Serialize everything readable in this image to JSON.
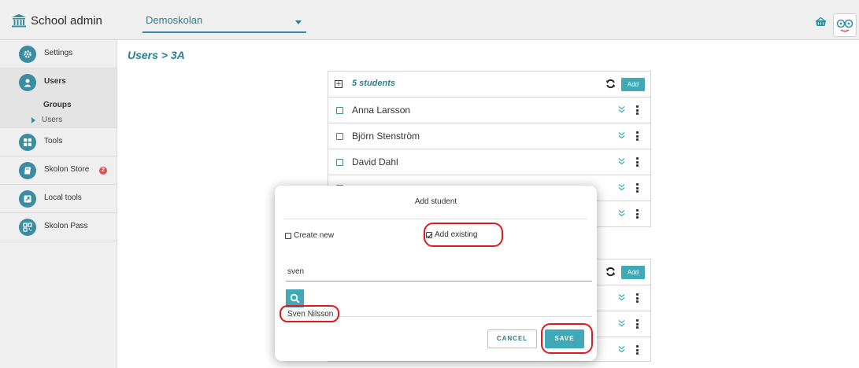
{
  "app": {
    "title": "School admin"
  },
  "header": {
    "school_selected": "Demoskolan"
  },
  "sidebar": {
    "items": [
      {
        "label": "Settings"
      },
      {
        "label": "Users"
      },
      {
        "label": "Tools"
      },
      {
        "label": "Skolon Store",
        "badge": "2"
      },
      {
        "label": "Local tools"
      },
      {
        "label": "Skolon Pass"
      }
    ],
    "sub_groups": "Groups",
    "sub_users": "Users"
  },
  "breadcrumb": "Users > 3A",
  "students_card": {
    "count_label": "5 students",
    "add_label": "Add",
    "rows": [
      "Anna Larsson",
      "Björn Stenström",
      "David Dahl",
      "",
      ""
    ]
  },
  "second_card": {
    "add_label": "Add"
  },
  "modal": {
    "title": "Add student",
    "option_create": "Create new",
    "option_existing": "Add existing",
    "search_value": "sven",
    "result": "Sven Nilsson",
    "cancel_label": "CANCEL",
    "save_label": "SAVE"
  },
  "colors": {
    "accent": "#3fa9b8",
    "accent_text": "#2a7f91",
    "badge": "#d9534f",
    "highlight": "#e0191f"
  }
}
